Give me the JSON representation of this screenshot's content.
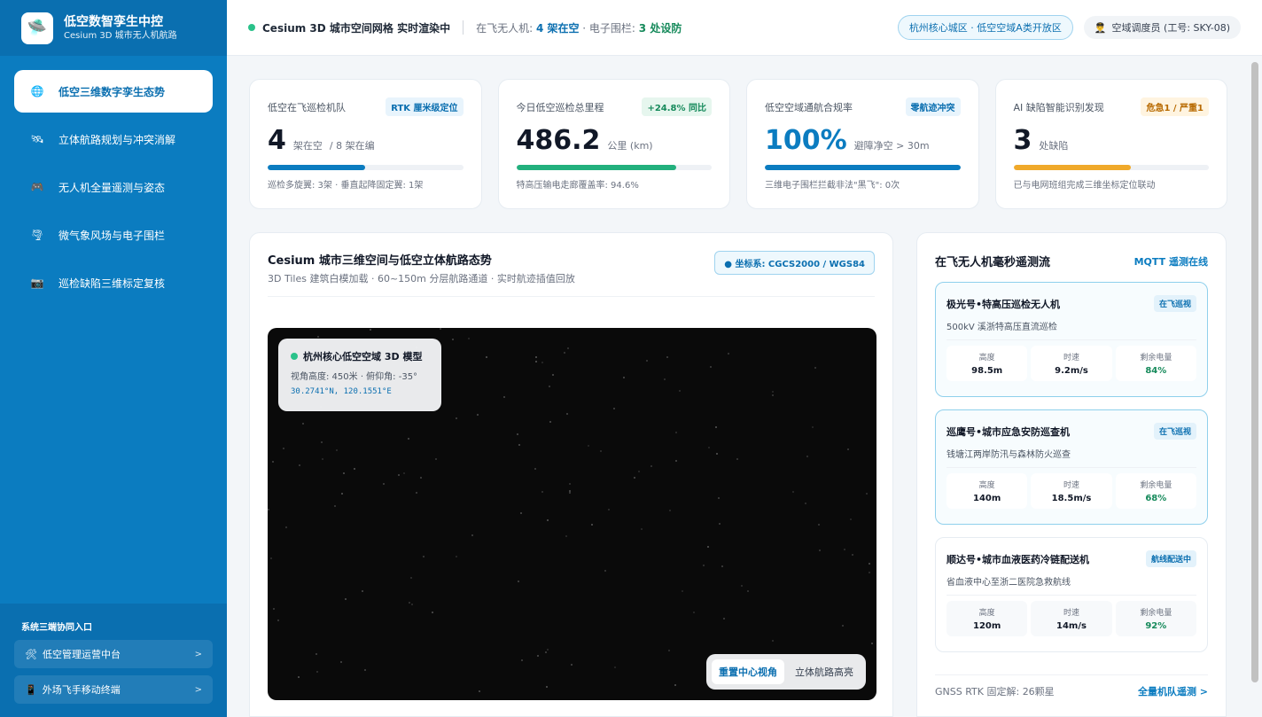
{
  "brand": {
    "title": "低空数智孪生中控",
    "subtitle": "Cesium 3D 城市无人机航路",
    "logo_icon": "drone-icon"
  },
  "sidebar": {
    "items": [
      {
        "label": "低空三维数字孪生态势",
        "icon": "globe-icon",
        "glyph": "🌐",
        "active": true
      },
      {
        "label": "立体航路规划与冲突消解",
        "icon": "satellite-icon",
        "glyph": "🛰",
        "active": false
      },
      {
        "label": "无人机全量遥测与姿态",
        "icon": "gamepad-icon",
        "glyph": "🎮",
        "active": false
      },
      {
        "label": "微气象风场与电子围栏",
        "icon": "tornado-icon",
        "glyph": "🌪",
        "active": false
      },
      {
        "label": "巡检缺陷三维标定复核",
        "icon": "camera-icon",
        "glyph": "📷",
        "active": false
      }
    ],
    "footer_title": "系统三端协同入口",
    "links": [
      {
        "label": "低空管理运营中台",
        "icon": "tools-icon",
        "glyph": "🛠"
      },
      {
        "label": "外场飞手移动终端",
        "icon": "phone-icon",
        "glyph": "📱"
      }
    ]
  },
  "header": {
    "status": "Cesium 3D 城市空间网格 实时渲染中",
    "meta_prefix": "在飞无人机: ",
    "meta_drones": "4 架在空",
    "meta_mid": " · 电子围栏: ",
    "meta_fences": "3 处设防",
    "zone": "杭州核心城区 · 低空空域A类开放区",
    "user": "空域调度员 (工号: SKY-08)",
    "user_icon": "user-icon"
  },
  "stats": [
    {
      "title": "低空在飞巡检机队",
      "tag": "RTK 厘米级定位",
      "value": "4",
      "unit": "架在空",
      "unit2": "/ 8 架在编",
      "progress": 0.5,
      "color": "#0b7cc0",
      "note": "巡检多旋翼: 3架 · 垂直起降固定翼: 1架"
    },
    {
      "title": "今日低空巡检总里程",
      "tag": "+24.8% 同比",
      "value": "486.2",
      "unit": "公里 (km)",
      "unit2": "",
      "progress": 0.82,
      "color": "#22b07d",
      "note": "特高压输电走廊覆盖率: 94.6%"
    },
    {
      "title": "低空空域通航合规率",
      "tag": "零航迹冲突",
      "value": "100%",
      "unit": "避障净空 > 30m",
      "unit2": "",
      "progress": 1.0,
      "color": "#0b7cc0",
      "note": "三维电子围栏拦截非法\"黑飞\": 0次"
    },
    {
      "title": "AI 缺陷智能识别发现",
      "tag": "危急1 / 严重1",
      "value": "3",
      "unit": "处缺陷",
      "unit2": "",
      "progress": 0.6,
      "color": "#f0a92a",
      "note": "已与电网班组完成三维坐标定位联动"
    }
  ],
  "map": {
    "title": "Cesium 城市三维空间与低空立体航路态势",
    "subtitle": "3D Tiles 建筑白模加载 · 60~150m 分层航路通道 · 实时航迹插值回放",
    "coord_system": "● 坐标系: CGCS2000 / WGS84",
    "info_title": "杭州核心低空空域 3D 模型",
    "info_view": "视角高度: 450米 · 俯仰角: -35°",
    "info_coord": "30.2741°N, 120.1551°E",
    "btn_reset": "重置中心视角",
    "btn_route": "立体航路高亮"
  },
  "telemetry": {
    "title": "在飞无人机毫秒遥测流",
    "status": "MQTT 遥测在线",
    "labels": {
      "alt": "高度",
      "speed": "时速",
      "battery": "剩余电量"
    },
    "uavs": [
      {
        "name": "极光号•特高压巡检无人机",
        "badge": "在飞巡视",
        "desc": "500kV 溪浙特高压直流巡检",
        "alt": "98.5m",
        "speed": "9.2m/s",
        "battery": "84%",
        "active": true
      },
      {
        "name": "巡鹰号•城市应急安防巡查机",
        "badge": "在飞巡视",
        "desc": "钱塘江两岸防汛与森林防火巡查",
        "alt": "140m",
        "speed": "18.5m/s",
        "battery": "68%",
        "active": true
      },
      {
        "name": "顺达号•城市血液医药冷链配送机",
        "badge": "航线配送中",
        "desc": "省血液中心至浙二医院急救航线",
        "alt": "120m",
        "speed": "14m/s",
        "battery": "92%",
        "active": false
      }
    ],
    "gnss": "GNSS RTK 固定解: 26颗星",
    "all_link": "全量机队遥测 >"
  }
}
